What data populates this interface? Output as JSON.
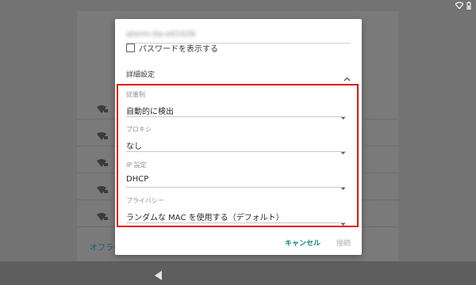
{
  "status_bar": {
    "icons": [
      "wifi-icon",
      "battery-icon"
    ]
  },
  "background": {
    "offline_label": "オフライン",
    "wifi_rows": 5
  },
  "dialog": {
    "ssid": "aterm-0a-e01026",
    "show_password": {
      "label": "パスワードを表示する",
      "checked": false
    },
    "advanced": {
      "label": "詳細設定",
      "expanded": true
    },
    "fields": [
      {
        "label": "従量制",
        "value": "自動的に検出"
      },
      {
        "label": "プロキシ",
        "value": "なし"
      },
      {
        "label": "IP 設定",
        "value": "DHCP"
      },
      {
        "label": "プライバシー",
        "value": "ランダムな MAC を使用する（デフォルト）"
      }
    ],
    "actions": {
      "cancel": "キャンセル",
      "connect": "接続"
    }
  },
  "colors": {
    "highlight": "#e3120b",
    "accent": "#16807c",
    "scrim": "#737373"
  }
}
